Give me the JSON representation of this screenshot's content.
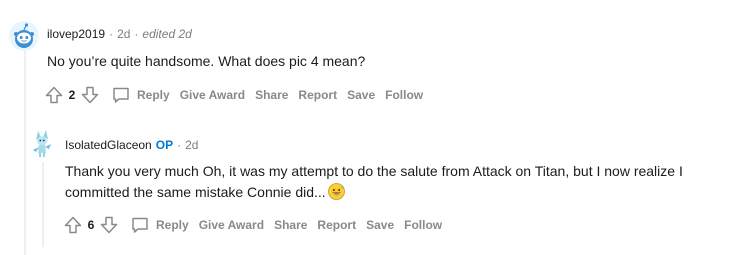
{
  "comment1": {
    "username": "ilovep2019",
    "time": "2d",
    "edited": "edited 2d",
    "body": "No you’re quite handsome. What does pic 4 mean?",
    "score": "2",
    "actions": {
      "reply": "Reply",
      "give_award": "Give Award",
      "share": "Share",
      "report": "Report",
      "save": "Save",
      "follow": "Follow"
    }
  },
  "comment2": {
    "username": "IsolatedGlaceon",
    "op_badge": "OP",
    "time": "2d",
    "body": "Thank you very much Oh, it was my attempt to do the salute from Attack on Titan, but I now realize I committed the same mistake Connie did...",
    "score": "6",
    "actions": {
      "reply": "Reply",
      "give_award": "Give Award",
      "share": "Share",
      "report": "Report",
      "save": "Save",
      "follow": "Follow"
    }
  },
  "separator": "·",
  "colors": {
    "accent": "#0079d3",
    "muted": "#878a8c",
    "thread": "#edeff1",
    "text": "#1c1c1c"
  }
}
